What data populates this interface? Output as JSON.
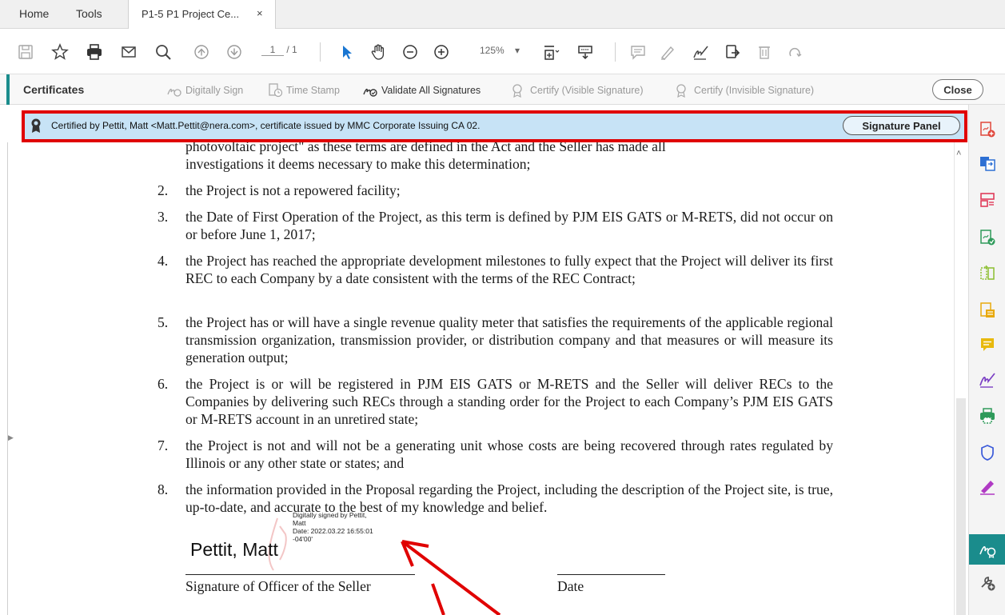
{
  "tabs": {
    "home": "Home",
    "tools": "Tools",
    "document": "P1-5 P1 Project Ce...",
    "close_glyph": "×"
  },
  "toolbar": {
    "page_current": "1",
    "page_total": "/ 1",
    "zoom": "125%",
    "zoom_caret": "▾"
  },
  "certificates_bar": {
    "title": "Certificates",
    "digitally_sign": "Digitally Sign",
    "time_stamp": "Time Stamp",
    "validate_all": "Validate All Signatures",
    "certify_visible": "Certify (Visible Signature)",
    "certify_invisible": "Certify (Invisible Signature)",
    "close": "Close"
  },
  "signature_bar": {
    "message": "Certified by Pettit, Matt <Matt.Pettit@nera.com>, certificate issued by MMC Corporate Issuing CA 02.",
    "panel_button": "Signature Panel"
  },
  "document": {
    "partial_line_1": "photovoltaic project\" as these terms are defined in the Act and the Seller has made all",
    "partial_line_2": "investigations it deems necessary to make this determination;",
    "items": [
      {
        "num": "2.",
        "text": "the Project is not a repowered facility;"
      },
      {
        "num": "3.",
        "text": "the Date of First Operation of the Project, as this term is defined by PJM EIS GATS or M-RETS, did not occur on or before June 1, 2017;"
      },
      {
        "num": "4.",
        "text": "the Project has reached the appropriate development milestones to fully expect that the Project will deliver its first REC to each Company by a date consistent with the terms of the REC Contract;"
      },
      {
        "num": "5.",
        "text": "the Project has or will have a single revenue quality meter that satisfies the requirements of the applicable regional transmission organization, transmission provider, or distribution company and that measures or will measure its generation output;"
      },
      {
        "num": "6.",
        "text": "the Project is or will be registered in PJM EIS GATS or M-RETS and the Seller will deliver RECs to the Companies by delivering such RECs through a standing order for the Project to each Company’s PJM EIS GATS or M-RETS account in an unretired state;"
      },
      {
        "num": "7.",
        "text": "the Project is not and will not be a generating unit whose costs are being recovered through rates regulated by Illinois or any other state or states; and"
      },
      {
        "num": "8.",
        "text": "the information provided in the Proposal regarding the Project, including the description of the Project site, is true, up-to-date, and accurate to the best of my knowledge and belief."
      }
    ],
    "signature": {
      "name": "Pettit, Matt",
      "detail_1": "Digitally signed by Pettit,",
      "detail_2": "Matt",
      "detail_3": "Date: 2022.03.22 16:55:01",
      "detail_4": "-04'00'",
      "officer_label": "Signature of Officer of the Seller",
      "date_label": "Date"
    }
  },
  "colors": {
    "accent_teal": "#1a8c8c",
    "highlight_red": "#e00000",
    "banner_blue": "#c7e3f6"
  }
}
